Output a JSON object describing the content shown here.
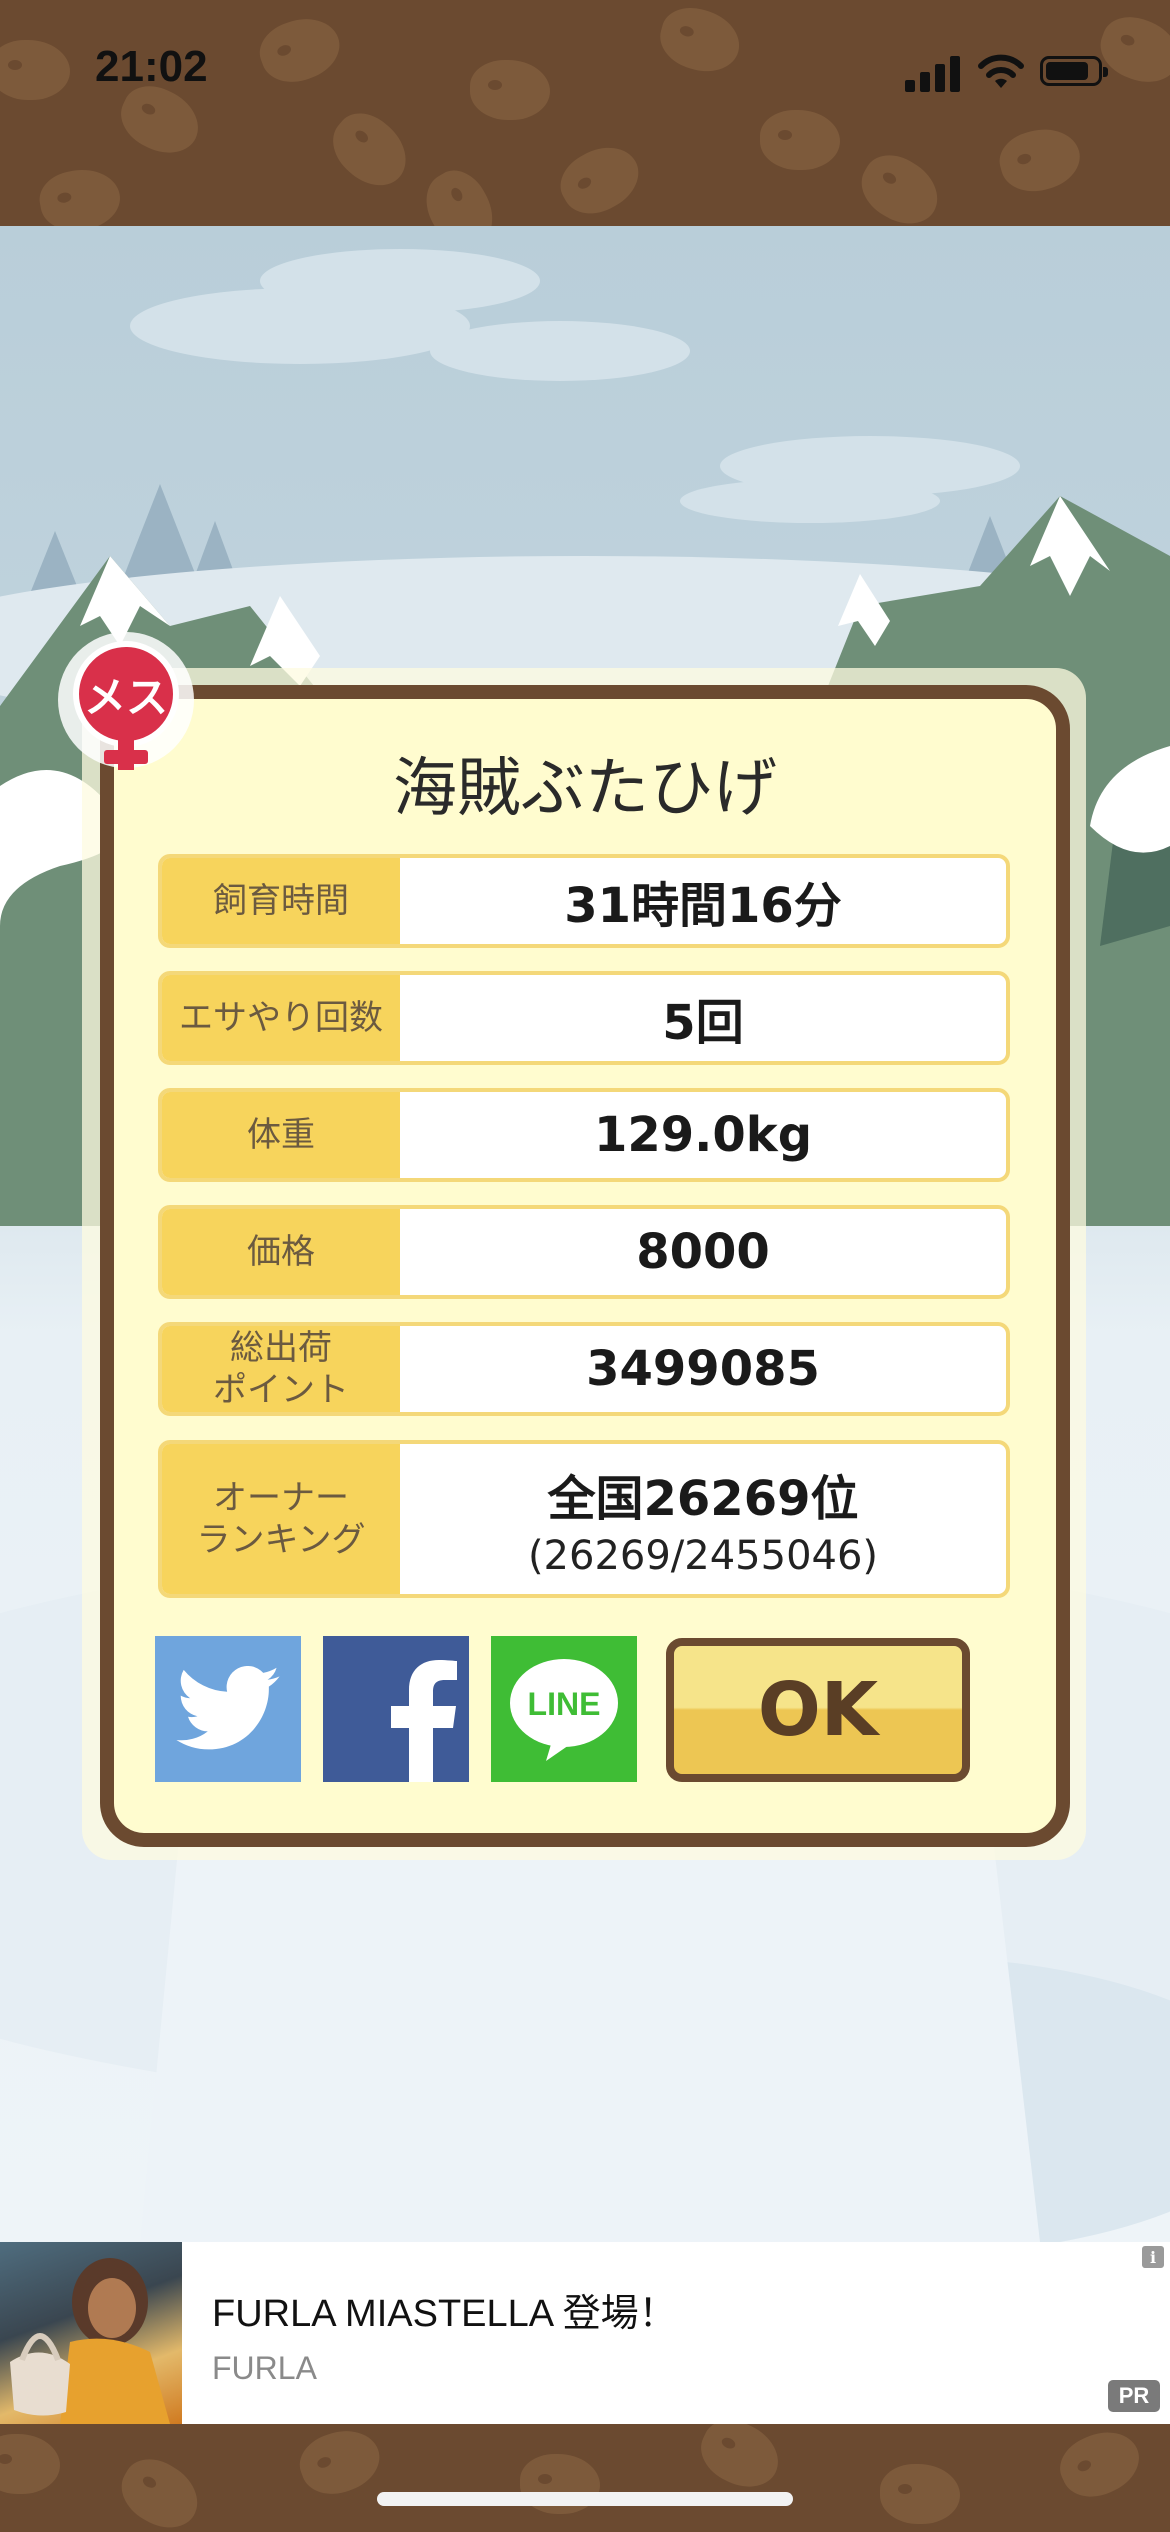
{
  "status_bar": {
    "time": "21:02"
  },
  "dialog": {
    "pig_name": "海賊ぶたひげ",
    "gender_badge": "メス",
    "rows": [
      {
        "label": "飼育時間",
        "value": "31時間16分"
      },
      {
        "label": "エサやり回数",
        "value": "5回"
      },
      {
        "label": "体重",
        "value": "129.0kg"
      },
      {
        "label": "価格",
        "value": "8000"
      },
      {
        "label_line1": "総出荷",
        "label_line2": "ポイント",
        "value": "3499085"
      },
      {
        "label_line1": "オーナー",
        "label_line2": "ランキング",
        "value": "全国26269位",
        "sub": "(26269/2455046)"
      }
    ],
    "share": {
      "twitter_icon": "twitter-bird-icon",
      "facebook_icon": "facebook-f-icon",
      "line_label": "LINE"
    },
    "ok_label": "OK"
  },
  "ad": {
    "title": "FURLA MIASTELLA 登場！",
    "advertiser": "FURLA",
    "info_badge": "i",
    "pr_badge": "PR"
  },
  "colors": {
    "frame_brown": "#6b4a30",
    "card_cream": "#fffccf",
    "label_yellow": "#f7d45c",
    "twitter_blue": "#6fa5dd",
    "facebook_blue": "#3f5b98",
    "line_green": "#3fbd35",
    "female_red": "#d9304a"
  }
}
